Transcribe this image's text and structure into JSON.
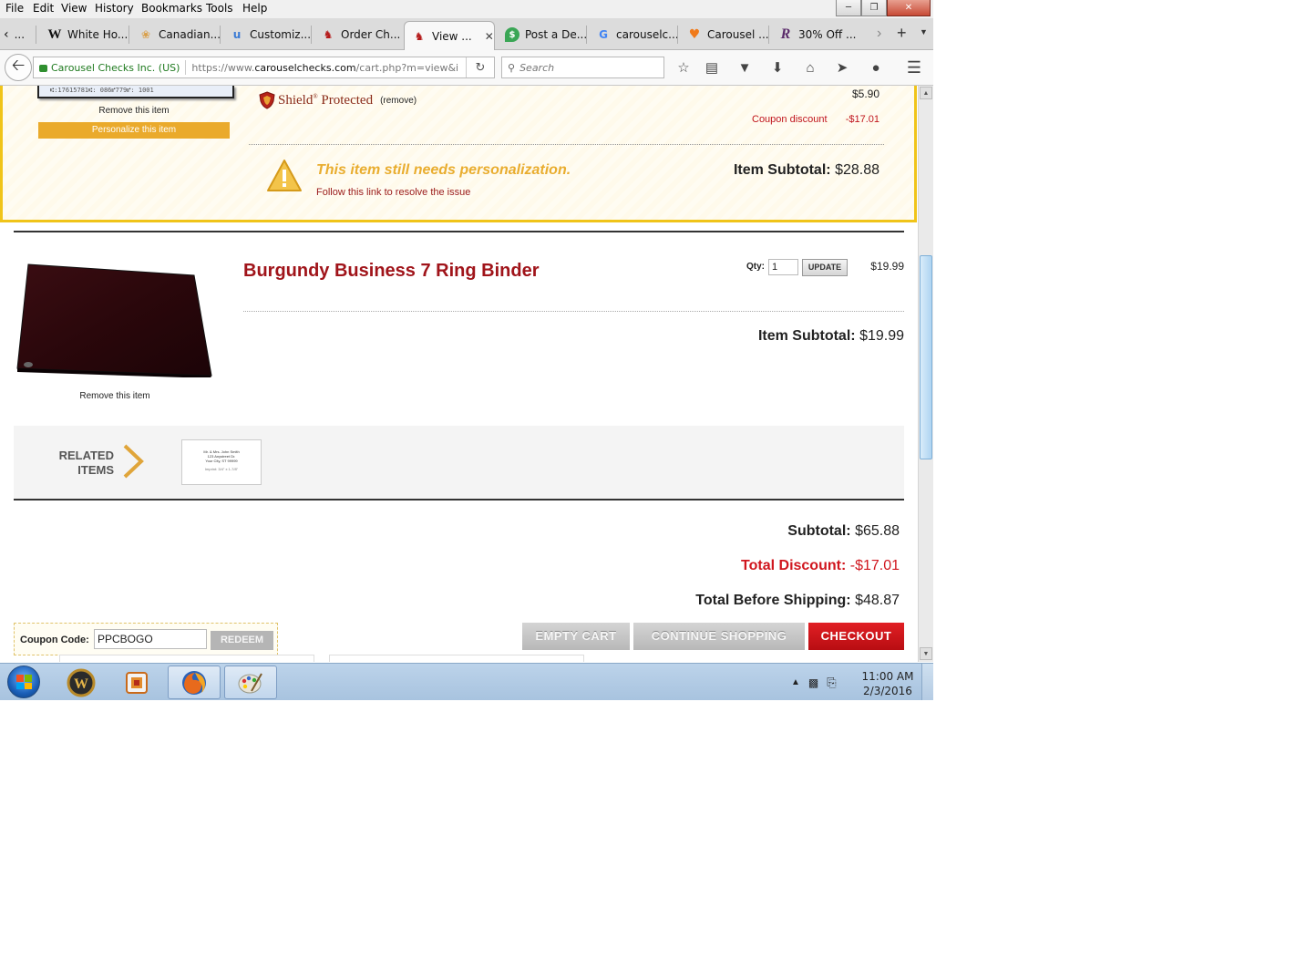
{
  "browser": {
    "menu": [
      "File",
      "Edit",
      "View",
      "History",
      "Bookmarks",
      "Tools",
      "Help"
    ],
    "tabs": [
      {
        "label": "...",
        "icon": "tab-scroll-left"
      },
      {
        "label": "White Ho...",
        "icon": "W"
      },
      {
        "label": "Canadian...",
        "icon": "maple"
      },
      {
        "label": "Customiz...",
        "icon": "u"
      },
      {
        "label": "Order Ch...",
        "icon": "horse"
      },
      {
        "label": "View ...",
        "icon": "horse",
        "active": true
      },
      {
        "label": "Post a De...",
        "icon": "$"
      },
      {
        "label": "carouselc...",
        "icon": "G"
      },
      {
        "label": "Carousel ...",
        "icon": "heart"
      },
      {
        "label": "30% Off ...",
        "icon": "R"
      }
    ],
    "identity": "Carousel Checks Inc. (US)",
    "url_prefix": "https://www.",
    "url_domain": "carouselchecks.com",
    "url_path": "/cart.php?m=view&i",
    "search_placeholder": "Search"
  },
  "cart": {
    "item1": {
      "thumb_text": "⑆:17615781⑆: 086⑈779⑈: 1001",
      "remove_label": "Remove this item",
      "personalize_label": "Personalize this item",
      "shield_label": "Shield",
      "shield_label2": "Protected",
      "shield_remove": "(remove)",
      "shield_price": "$5.90",
      "coupon_label": "Coupon discount",
      "coupon_value": "-$17.01",
      "warning_message": "This item still needs personalization.",
      "warning_link": "Follow this link to resolve the issue",
      "subtotal_label": "Item Subtotal:",
      "subtotal_value": "$28.88"
    },
    "item2": {
      "title": "Burgundy Business 7 Ring Binder",
      "qty_label": "Qty:",
      "qty_value": "1",
      "update_label": "UPDATE",
      "price": "$19.99",
      "remove_label": "Remove this item",
      "subtotal_label": "Item Subtotal:",
      "subtotal_value": "$19.99"
    },
    "related": {
      "label_line1": "RELATED",
      "label_line2": "ITEMS",
      "card_lines": [
        "Mr. & Mrs. John Smith",
        "123 Anystreet Dr.",
        "Your City, ST 99999",
        "Imprint: 3/4\" x 1-7/8\""
      ]
    },
    "totals": {
      "subtotal_label": "Subtotal:",
      "subtotal_value": "$65.88",
      "discount_label": "Total Discount:",
      "discount_value": "-$17.01",
      "before_shipping_label": "Total Before Shipping:",
      "before_shipping_value": "$48.87"
    },
    "coupon": {
      "label": "Coupon Code:",
      "value": "PPCBOGO",
      "redeem_label": "REDEEM"
    },
    "buttons": {
      "empty_cart": "EMPTY CART",
      "continue_shopping": "CONTINUE SHOPPING",
      "checkout": "CHECKOUT"
    }
  },
  "taskbar": {
    "time": "11:00 AM",
    "date": "2/3/2016"
  },
  "colors": {
    "accent_red": "#c0141c",
    "warning_yellow": "#f0c419",
    "personalize_orange": "#eaaa2b",
    "checkout_red": "#d0161e"
  }
}
